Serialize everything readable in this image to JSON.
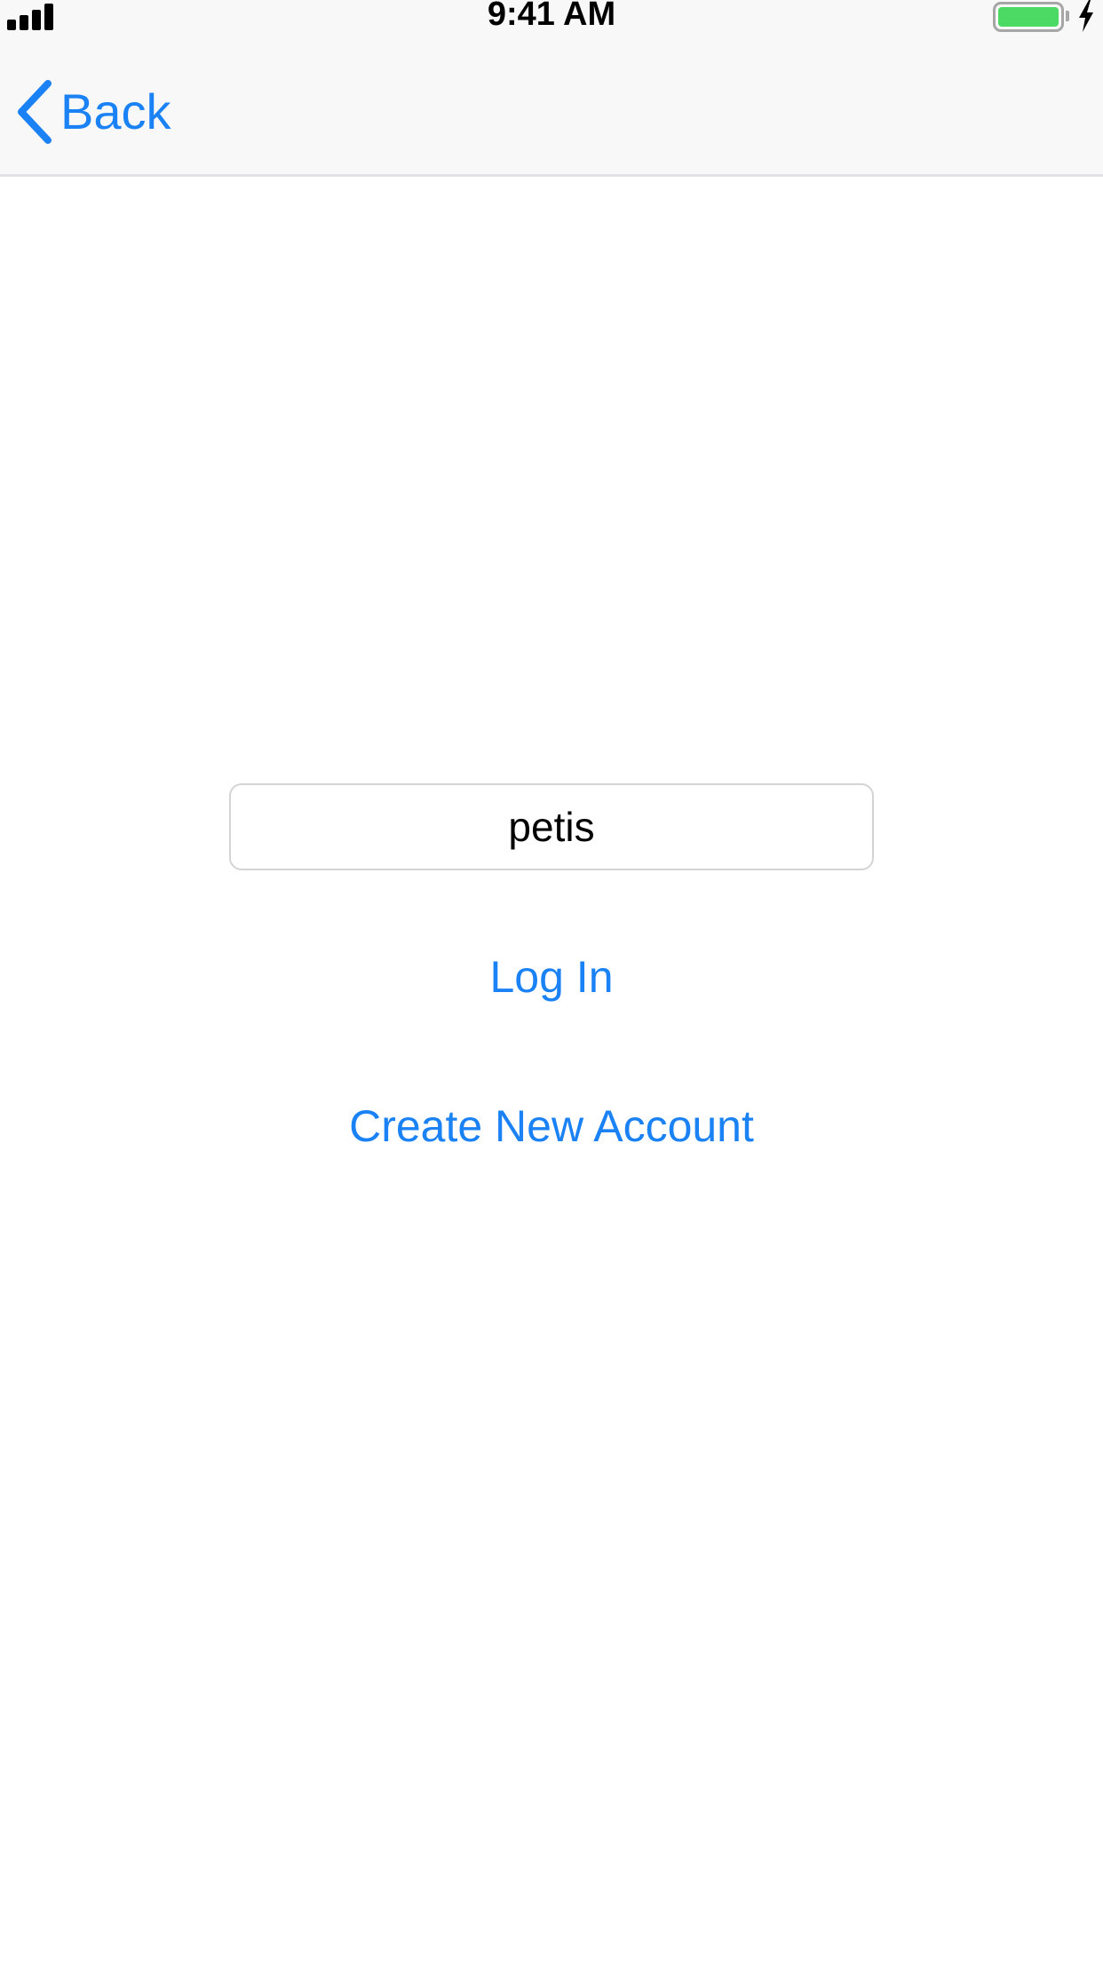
{
  "status_bar": {
    "time": "9:41 AM",
    "signal_icon": "cellular-signal-icon",
    "battery_icon": "battery-charging-icon",
    "battery_level": 1.0,
    "battery_color": "#4cd964"
  },
  "nav": {
    "back_label": "Back",
    "back_icon": "chevron-left-icon",
    "accent_color": "#1a82f5"
  },
  "login_form": {
    "username_value": "petis",
    "login_label": "Log In",
    "create_account_label": "Create New Account"
  }
}
